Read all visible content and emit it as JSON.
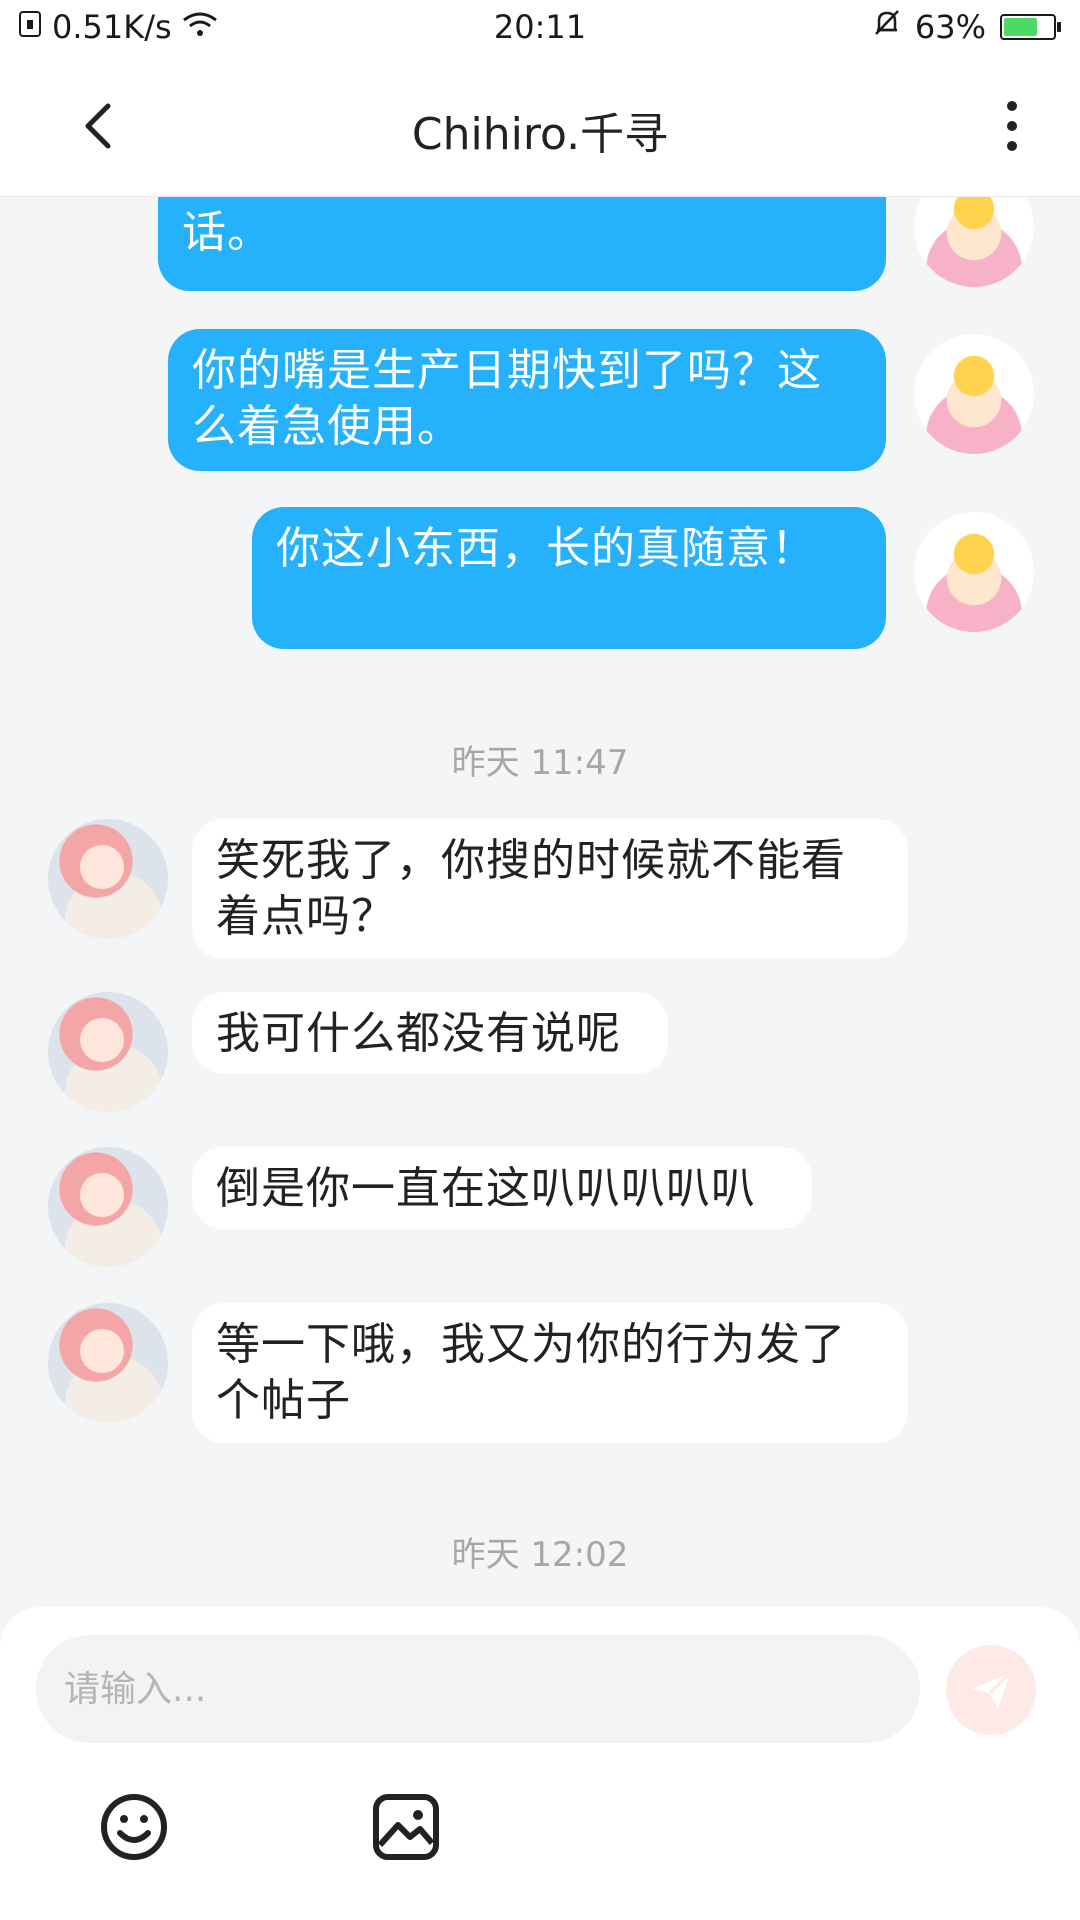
{
  "status_bar": {
    "speed": "0.51K/s",
    "time": "20:11",
    "battery": "63%",
    "battery_level": 0.63
  },
  "header": {
    "title": "Chihiro.千寻"
  },
  "messages": [
    {
      "side": "out",
      "text": "快闭嘴吧!估计算了都受不了你废话。"
    },
    {
      "side": "out",
      "text": "你的嘴是生产日期快到了吗？这么着急使用。"
    },
    {
      "side": "out",
      "text": "你这小东西，长的真随意！"
    },
    {
      "side": "time",
      "text": "昨天 11:47"
    },
    {
      "side": "in",
      "text": "笑死我了，你搜的时候就不能看着点吗？"
    },
    {
      "side": "in",
      "text": "我可什么都没有说呢"
    },
    {
      "side": "in",
      "text": "倒是你一直在这叭叭叭叭叭"
    },
    {
      "side": "in",
      "text": "等一下哦，我又为你的行为发了个帖子"
    },
    {
      "side": "time",
      "text": "昨天 12:02"
    }
  ],
  "composer": {
    "placeholder": "请输入..."
  },
  "icons": {
    "back": "chevron-left-icon",
    "more": "more-vertical-icon",
    "send": "send-icon",
    "emoji": "emoji-icon",
    "image": "image-icon"
  },
  "colors": {
    "outgoing_bubble": "#26b1fc",
    "incoming_bubble": "#ffffff",
    "send_button": "#fde9e6"
  }
}
